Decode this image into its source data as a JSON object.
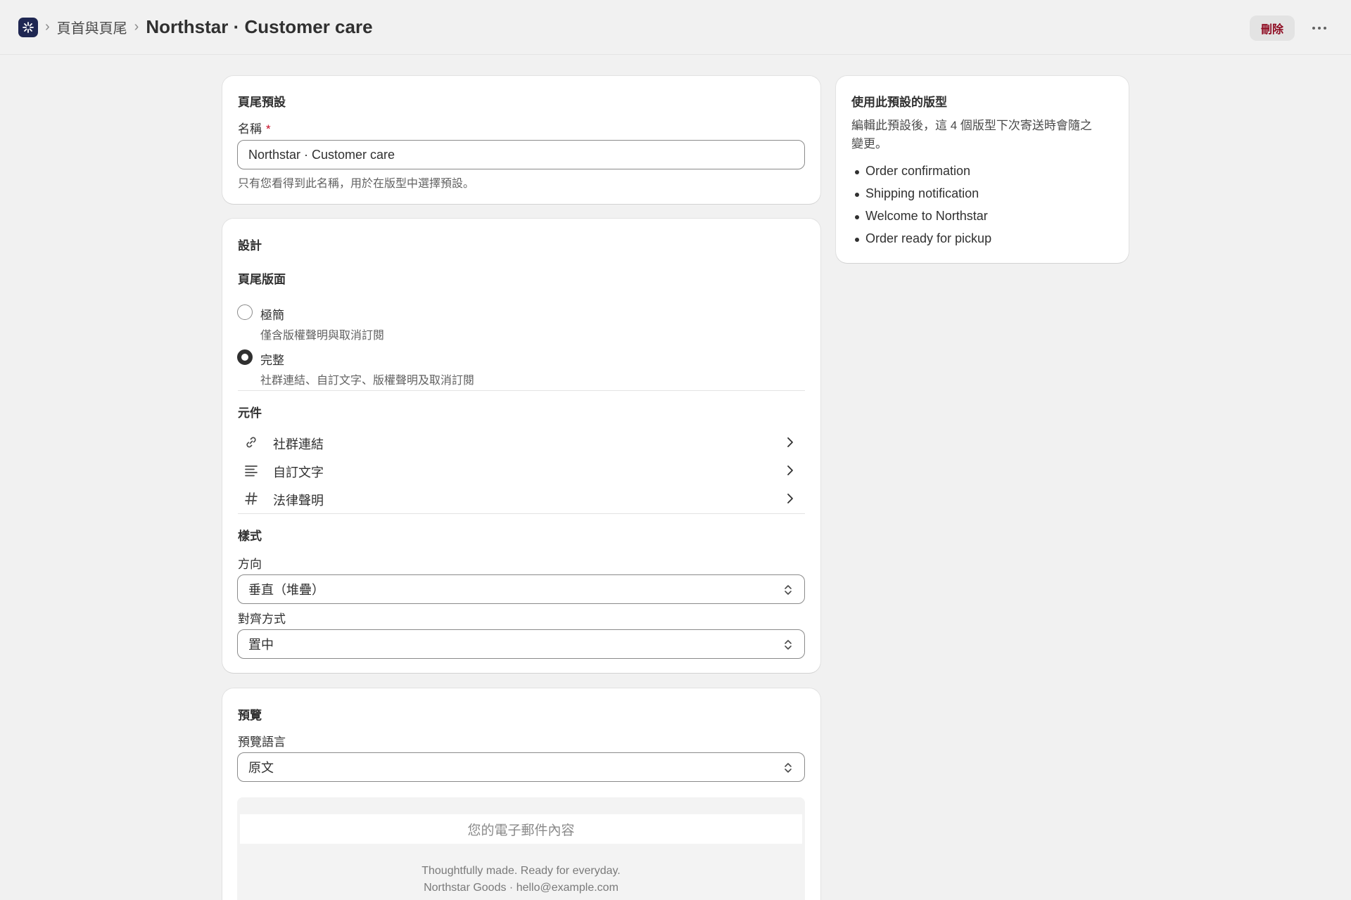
{
  "header": {
    "breadcrumb_parent": "頁首與頁尾",
    "title": "Northstar · Customer care",
    "delete_label": "刪除",
    "more_label": "···"
  },
  "preset_card": {
    "title": "頁尾預設",
    "name_label": "名稱",
    "required_mark": "*",
    "name_value": "Northstar · Customer care",
    "help": "只有您看得到此名稱，用於在版型中選擇預設。"
  },
  "design_card": {
    "title": "設計",
    "layout_heading": "頁尾版面",
    "options": [
      {
        "label": "極簡",
        "desc": "僅含版權聲明與取消訂閱",
        "checked": false
      },
      {
        "label": "完整",
        "desc": "社群連結、自訂文字、版權聲明及取消訂閱",
        "checked": true
      }
    ],
    "elements_heading": "元件",
    "elements": [
      {
        "label": "社群連結",
        "icon": "link-icon"
      },
      {
        "label": "自訂文字",
        "icon": "text-align-icon"
      },
      {
        "label": "法律聲明",
        "icon": "hash-icon"
      }
    ],
    "style_heading": "樣式",
    "direction_label": "方向",
    "direction_value": "垂直（堆疊）",
    "align_label": "對齊方式",
    "align_value": "置中"
  },
  "preview_card": {
    "title": "預覽",
    "lang_label": "預覽語言",
    "lang_value": "原文",
    "email_placeholder": "您的電子郵件內容",
    "footer_line1": "Thoughtfully made. Ready for everyday.",
    "footer_line2": "Northstar Goods · hello@example.com"
  },
  "side_card": {
    "title": "使用此預設的版型",
    "description_line1": "編輯此預設後，這 4 個版型下次寄送時會隨之",
    "description_line2": "變更。",
    "templates": [
      "Order confirmation",
      "Shipping notification",
      "Welcome to Northstar",
      "Order ready for pickup"
    ]
  },
  "colors": {
    "background": "#f1f1f1",
    "card": "#ffffff",
    "danger_text": "#8e0b21",
    "app_icon": "#1f2752"
  }
}
